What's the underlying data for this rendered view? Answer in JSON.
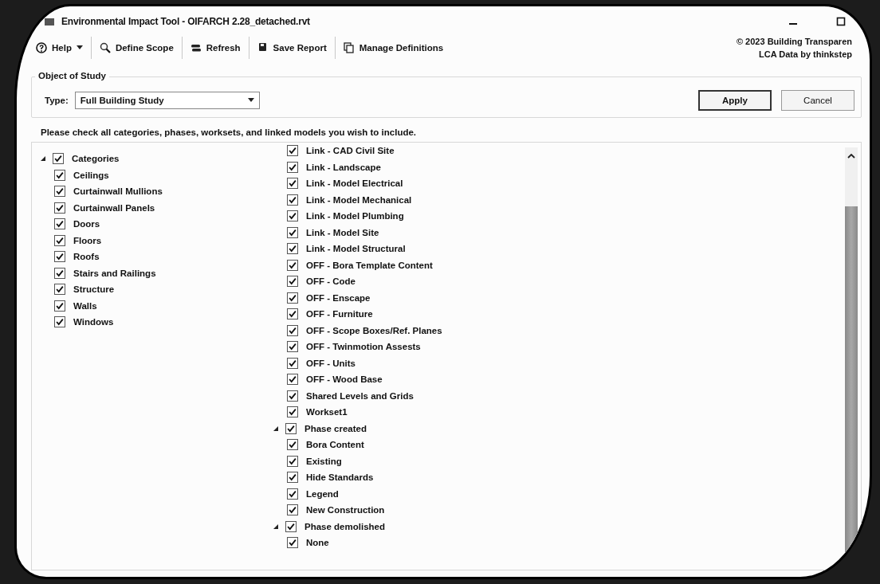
{
  "window": {
    "title": "Environmental Impact Tool - OIFARCH 2.28_detached.rvt"
  },
  "toolbar": [
    {
      "label": "Help",
      "kind": "dropdown"
    },
    {
      "label": "Define Scope",
      "kind": "button"
    },
    {
      "label": "Refresh",
      "kind": "button"
    },
    {
      "label": "Save Report",
      "kind": "button"
    },
    {
      "label": "Manage Definitions",
      "kind": "button"
    }
  ],
  "credits": [
    "© 2023 Building Transparen",
    "LCA Data by thinkstep"
  ],
  "object_of_study": {
    "title": "Object of Study",
    "type_label": "Type:",
    "type_value": "Full Building Study",
    "buttons": [
      {
        "label": "Apply",
        "default": true
      },
      {
        "label": "Cancel",
        "default": false
      }
    ]
  },
  "instruction": "Please check all categories, phases, worksets, and linked models you wish to include.",
  "tree": {
    "first_column": [
      {
        "label": "Categories",
        "checked": true,
        "expanded": true,
        "children": [
          {
            "label": "Ceilings",
            "checked": true
          },
          {
            "label": "Curtainwall Mullions",
            "checked": true
          },
          {
            "label": "Curtainwall Panels",
            "checked": true
          },
          {
            "label": "Doors",
            "checked": true
          },
          {
            "label": "Floors",
            "checked": true
          },
          {
            "label": "Roofs",
            "checked": true
          },
          {
            "label": "Stairs and Railings",
            "checked": true
          },
          {
            "label": "Structure",
            "checked": true
          },
          {
            "label": "Walls",
            "checked": true
          },
          {
            "label": "Windows",
            "checked": true
          }
        ]
      }
    ],
    "second_column": {
      "continued": [
        {
          "label": "Link - CAD Civil Site",
          "checked": true
        },
        {
          "label": "Link - Landscape",
          "checked": true
        },
        {
          "label": "Link - Model Electrical",
          "checked": true
        },
        {
          "label": "Link - Model Mechanical",
          "checked": true
        },
        {
          "label": "Link - Model Plumbing",
          "checked": true
        },
        {
          "label": "Link - Model Site",
          "checked": true
        },
        {
          "label": "Link - Model Structural",
          "checked": true
        },
        {
          "label": "OFF - Bora Template Content",
          "checked": true
        },
        {
          "label": "OFF - Code",
          "checked": true
        },
        {
          "label": "OFF - Enscape",
          "checked": true
        },
        {
          "label": "OFF - Furniture",
          "checked": true
        },
        {
          "label": "OFF - Scope Boxes/Ref. Planes",
          "checked": true
        },
        {
          "label": "OFF - Twinmotion Assests",
          "checked": true
        },
        {
          "label": "OFF - Units",
          "checked": true
        },
        {
          "label": "OFF - Wood Base",
          "checked": true
        },
        {
          "label": "Shared Levels and Grids",
          "checked": true
        },
        {
          "label": "Workset1",
          "checked": true
        }
      ],
      "nodes": [
        {
          "label": "Phase created",
          "checked": true,
          "expanded": true,
          "children": [
            {
              "label": "Bora Content",
              "checked": true
            },
            {
              "label": "Existing",
              "checked": true
            },
            {
              "label": "Hide Standards",
              "checked": true
            },
            {
              "label": "Legend",
              "checked": true
            },
            {
              "label": "New Construction",
              "checked": true
            }
          ]
        },
        {
          "label": "Phase demolished",
          "checked": true,
          "expanded": true,
          "children": [
            {
              "label": "None",
              "checked": true
            }
          ]
        }
      ]
    }
  }
}
